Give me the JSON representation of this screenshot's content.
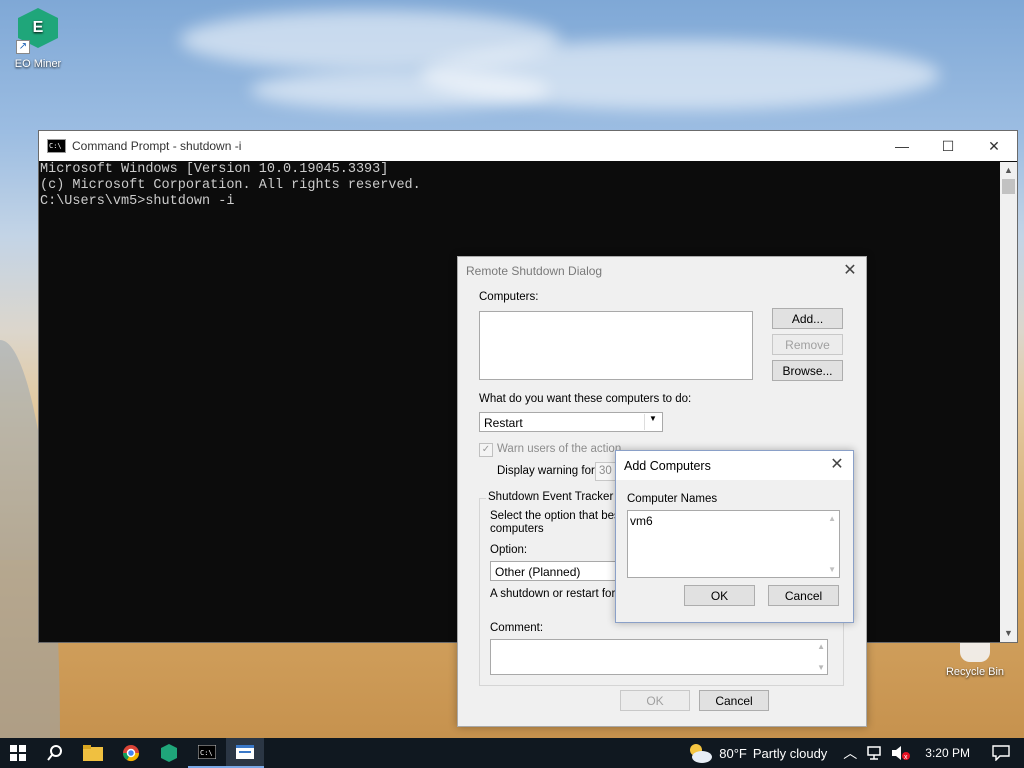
{
  "desktop": {
    "icons": [
      {
        "label": "EO Miner",
        "glyph": "E"
      },
      {
        "label": "Recycle Bin"
      }
    ]
  },
  "cmd": {
    "title": "Command Prompt - shutdown  -i",
    "icon_text": "C:\\",
    "lines": [
      "Microsoft Windows [Version 10.0.19045.3393]",
      "(c) Microsoft Corporation. All rights reserved.",
      "",
      "C:\\Users\\vm5>shutdown -i"
    ],
    "controls": {
      "minimize": "—",
      "maximize": "☐",
      "close": "✕"
    }
  },
  "remote_shutdown": {
    "title": "Remote Shutdown Dialog",
    "computers_label": "Computers:",
    "add_button": "Add...",
    "remove_button": "Remove",
    "browse_button": "Browse...",
    "action_label": "What do you want these computers to do:",
    "action_value": "Restart",
    "warn_label": "Warn users of the action",
    "display_warning_label": "Display warning for",
    "display_warning_value": "30",
    "tracker_label": "Shutdown Event Tracker",
    "select_option_text_1": "Select the option that best",
    "select_option_text_2": "computers",
    "option_label": "Option:",
    "option_value": "Other (Planned)",
    "description_text": "A shutdown or restart for a",
    "comment_label": "Comment:",
    "ok_button": "OK",
    "cancel_button": "Cancel"
  },
  "add_computers": {
    "title": "Add Computers",
    "names_label": "Computer Names",
    "names_value": "vm6",
    "ok_button": "OK",
    "cancel_button": "Cancel"
  },
  "taskbar": {
    "weather_temp": "80°F",
    "weather_desc": "Partly cloudy",
    "time": "3:20 PM"
  },
  "colors": {
    "taskbar": "#101820",
    "cmd_background": "#0c0c0c",
    "cmd_text": "#cccccc",
    "dialog_background": "#f0f0f0"
  }
}
